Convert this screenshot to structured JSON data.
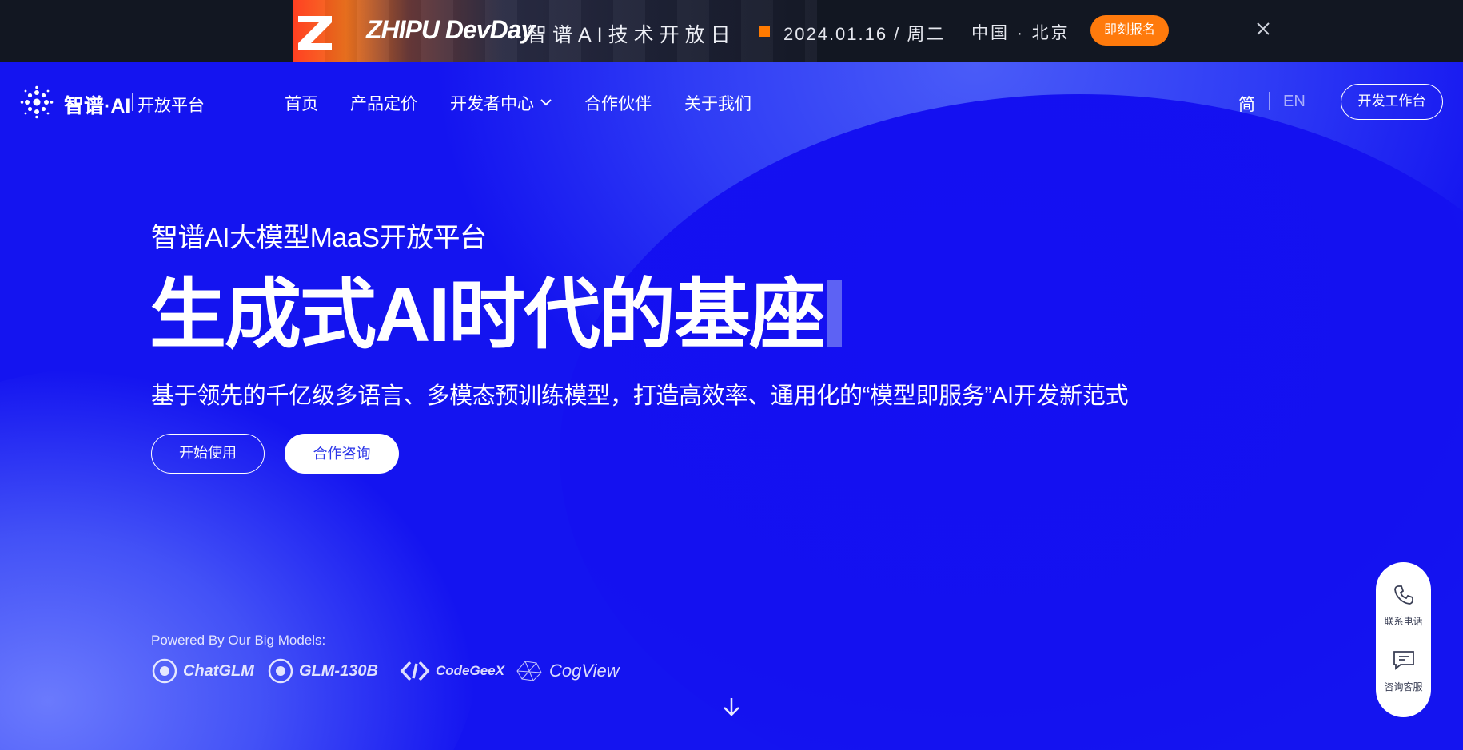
{
  "banner": {
    "brand": "ZHIPU DevDay",
    "subtitle": "智谱AI技术开放日",
    "date": "2024.01.16 / 周二",
    "location": "中国 · 北京",
    "signup_label": "即刻报名",
    "close_icon": "close-icon",
    "colors": {
      "background": "#121722",
      "accent": "#ff7a0c"
    }
  },
  "nav": {
    "brand": "智谱·AI",
    "platform": "开放平台",
    "items": [
      {
        "label": "首页"
      },
      {
        "label": "产品定价"
      },
      {
        "label": "开发者中心",
        "has_dropdown": true
      },
      {
        "label": "合作伙伴"
      },
      {
        "label": "关于我们"
      }
    ],
    "lang_zh": "简",
    "lang_en": "EN",
    "workbench_label": "开发工作台"
  },
  "hero": {
    "kicker": "智谱AI大模型MaaS开放平台",
    "title": "生成式AI时代的基座",
    "subtitle": "基于领先的千亿级多语言、多模态预训练模型，打造高效率、通用化的“模型即服务”AI开发新范式",
    "start_label": "开始使用",
    "consult_label": "合作咨询",
    "colors": {
      "background": "#1414f0",
      "consult_text": "#2b35e8"
    }
  },
  "powered": {
    "label": "Powered By Our Big Models:",
    "models": [
      {
        "name": "ChatGLM",
        "icon": "chatglm-logo-icon"
      },
      {
        "name": "GLM-130B",
        "icon": "glm-logo-icon"
      },
      {
        "name": "CodeGeeX",
        "icon": "codegeex-logo-icon"
      },
      {
        "name": "CogView",
        "icon": "cogview-logo-icon"
      }
    ]
  },
  "side_panel": {
    "phone_label": "联系电话",
    "service_label": "咨询客服"
  }
}
